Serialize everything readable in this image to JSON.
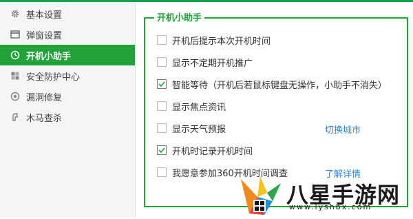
{
  "sidebar": {
    "items": [
      {
        "label": "基本设置",
        "icon": "gear-icon"
      },
      {
        "label": "弹窗设置",
        "icon": "window-icon"
      },
      {
        "label": "开机小助手",
        "icon": "clock-icon",
        "active": true
      },
      {
        "label": "安全防护中心",
        "icon": "shield-icon"
      },
      {
        "label": "漏洞修复",
        "icon": "patch-icon"
      },
      {
        "label": "木马查杀",
        "icon": "trojan-icon"
      }
    ]
  },
  "group": {
    "title": "开机小助手",
    "options": [
      {
        "label": "开机后提示本次开机时间",
        "checked": false
      },
      {
        "label": "显示不定期开机推广",
        "checked": false
      },
      {
        "label": "智能等待（开机后若鼠标键盘无操作，小助手不消失）",
        "checked": true
      },
      {
        "label": "显示焦点资讯",
        "checked": false
      },
      {
        "label": "显示天气预报",
        "checked": false
      },
      {
        "label": "开机时记录开机时间",
        "checked": true
      },
      {
        "label": "我愿意参加360开机时间调查",
        "checked": false
      }
    ],
    "links": {
      "switch_city": "切换城市",
      "learn_more": "了解详情"
    }
  },
  "watermark": {
    "title": "八星手游网",
    "url": "www.lyshbx.com"
  },
  "colors": {
    "accent": "#21a33a",
    "link": "#2b8ae0"
  }
}
